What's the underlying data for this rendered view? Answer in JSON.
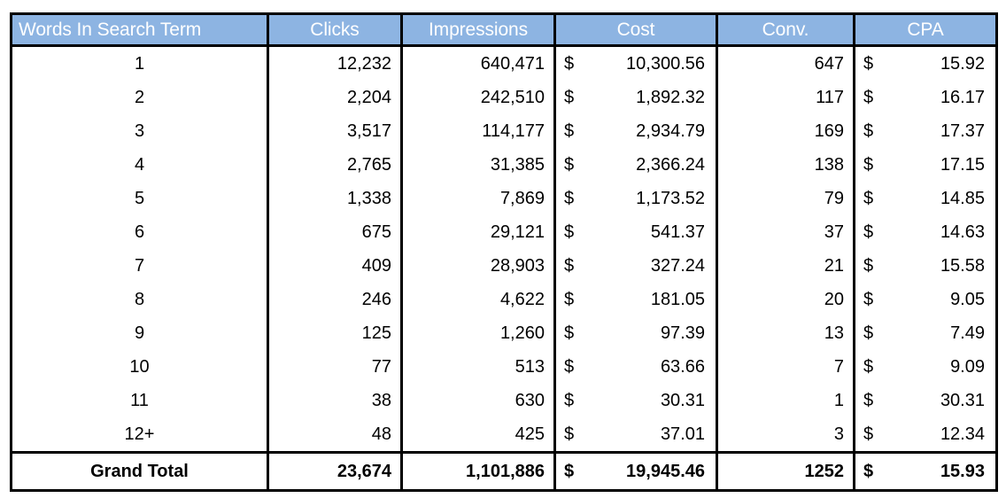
{
  "table": {
    "accent_header_bg": "#8DB4E2",
    "header_text_color": "#FFFFFF",
    "border_color": "#000000",
    "columns": [
      {
        "key": "words",
        "label": "Words In Search Term",
        "align": "left"
      },
      {
        "key": "clicks",
        "label": "Clicks",
        "align": "center"
      },
      {
        "key": "impr",
        "label": "Impressions",
        "align": "center"
      },
      {
        "key": "cost",
        "label": "Cost",
        "align": "center"
      },
      {
        "key": "conv",
        "label": "Conv.",
        "align": "center"
      },
      {
        "key": "cpa",
        "label": "CPA",
        "align": "center"
      }
    ],
    "currency_symbol": "$",
    "rows": [
      {
        "words": "1",
        "clicks": "12,232",
        "impr": "640,471",
        "cost_sym": "$",
        "cost": "10,300.56",
        "conv": "647",
        "cpa_sym": "$",
        "cpa": "15.92"
      },
      {
        "words": "2",
        "clicks": "2,204",
        "impr": "242,510",
        "cost_sym": "$",
        "cost": "1,892.32",
        "conv": "117",
        "cpa_sym": "$",
        "cpa": "16.17"
      },
      {
        "words": "3",
        "clicks": "3,517",
        "impr": "114,177",
        "cost_sym": "$",
        "cost": "2,934.79",
        "conv": "169",
        "cpa_sym": "$",
        "cpa": "17.37"
      },
      {
        "words": "4",
        "clicks": "2,765",
        "impr": "31,385",
        "cost_sym": "$",
        "cost": "2,366.24",
        "conv": "138",
        "cpa_sym": "$",
        "cpa": "17.15"
      },
      {
        "words": "5",
        "clicks": "1,338",
        "impr": "7,869",
        "cost_sym": "$",
        "cost": "1,173.52",
        "conv": "79",
        "cpa_sym": "$",
        "cpa": "14.85"
      },
      {
        "words": "6",
        "clicks": "675",
        "impr": "29,121",
        "cost_sym": "$",
        "cost": "541.37",
        "conv": "37",
        "cpa_sym": "$",
        "cpa": "14.63"
      },
      {
        "words": "7",
        "clicks": "409",
        "impr": "28,903",
        "cost_sym": "$",
        "cost": "327.24",
        "conv": "21",
        "cpa_sym": "$",
        "cpa": "15.58"
      },
      {
        "words": "8",
        "clicks": "246",
        "impr": "4,622",
        "cost_sym": "$",
        "cost": "181.05",
        "conv": "20",
        "cpa_sym": "$",
        "cpa": "9.05"
      },
      {
        "words": "9",
        "clicks": "125",
        "impr": "1,260",
        "cost_sym": "$",
        "cost": "97.39",
        "conv": "13",
        "cpa_sym": "$",
        "cpa": "7.49"
      },
      {
        "words": "10",
        "clicks": "77",
        "impr": "513",
        "cost_sym": "$",
        "cost": "63.66",
        "conv": "7",
        "cpa_sym": "$",
        "cpa": "9.09"
      },
      {
        "words": "11",
        "clicks": "38",
        "impr": "630",
        "cost_sym": "$",
        "cost": "30.31",
        "conv": "1",
        "cpa_sym": "$",
        "cpa": "30.31"
      },
      {
        "words": "12+",
        "clicks": "48",
        "impr": "425",
        "cost_sym": "$",
        "cost": "37.01",
        "conv": "3",
        "cpa_sym": "$",
        "cpa": "12.34"
      }
    ],
    "total_row": {
      "words": "Grand Total",
      "clicks": "23,674",
      "impr": "1,101,886",
      "cost_sym": "$",
      "cost": "19,945.46",
      "conv": "1252",
      "cpa_sym": "$",
      "cpa": "15.93"
    }
  }
}
